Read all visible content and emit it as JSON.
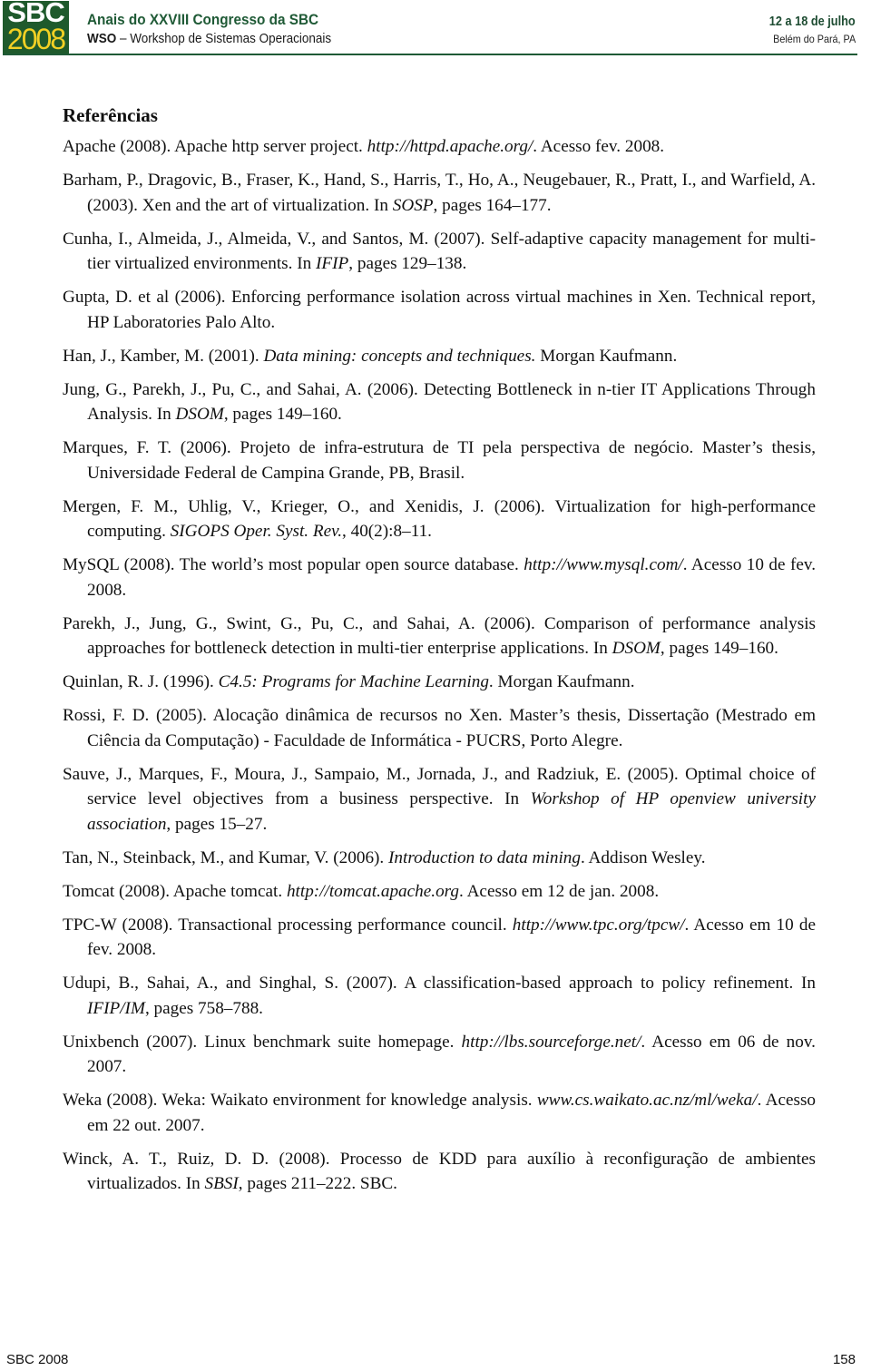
{
  "header": {
    "logo_line1": "SBC",
    "logo_line2": "2008",
    "title": "Anais do XXVIII Congresso da SBC",
    "subtitle_bold": "WSO",
    "subtitle_rest": " – Workshop de Sistemas Operacionais",
    "date": "12 a 18 de julho",
    "place": "Belém do Pará, PA",
    "colors": {
      "brand_green": "#1f5a2c",
      "logo_yellow": "#f2d024"
    }
  },
  "section_title": "Referências",
  "references": [
    [
      {
        "t": "Apache (2008). Apache http server project. "
      },
      {
        "t": "http://httpd.apache.org/",
        "i": true
      },
      {
        "t": ". Acesso fev. 2008."
      }
    ],
    [
      {
        "t": "Barham, P., Dragovic, B., Fraser, K., Hand, S., Harris, T., Ho, A., Neugebauer, R., Pratt, I., and Warfield, A. (2003). Xen and the art of virtualization. In "
      },
      {
        "t": "SOSP",
        "i": true
      },
      {
        "t": ", pages 164–177."
      }
    ],
    [
      {
        "t": "Cunha, I., Almeida, J., Almeida, V., and Santos, M. (2007). Self-adaptive capacity management for multi-tier virtualized environments. In "
      },
      {
        "t": "IFIP",
        "i": true
      },
      {
        "t": ", pages 129–138."
      }
    ],
    [
      {
        "t": "Gupta, D. et al (2006). Enforcing performance isolation across virtual machines in Xen. Technical report, HP Laboratories Palo Alto."
      }
    ],
    [
      {
        "t": "Han, J., Kamber, M. (2001). "
      },
      {
        "t": "Data mining: concepts and techniques.",
        "i": true
      },
      {
        "t": " Morgan Kaufmann."
      }
    ],
    [
      {
        "t": "Jung, G., Parekh, J., Pu, C., and Sahai, A. (2006). Detecting Bottleneck in n-tier IT Applications Through Analysis. In "
      },
      {
        "t": "DSOM",
        "i": true
      },
      {
        "t": ", pages 149–160."
      }
    ],
    [
      {
        "t": "Marques, F. T. (2006). Projeto de infra-estrutura de TI pela perspectiva de negócio. Master’s thesis, Universidade Federal de Campina Grande, PB, Brasil."
      }
    ],
    [
      {
        "t": "Mergen, F. M., Uhlig, V., Krieger, O., and Xenidis, J. (2006). Virtualization for high-performance computing. "
      },
      {
        "t": "SIGOPS Oper. Syst. Rev.",
        "i": true
      },
      {
        "t": ", 40(2):8–11."
      }
    ],
    [
      {
        "t": "MySQL (2008). The world’s most popular open source database. "
      },
      {
        "t": "http://www.mysql.com/",
        "i": true
      },
      {
        "t": ". Acesso 10 de fev. 2008."
      }
    ],
    [
      {
        "t": "Parekh, J., Jung, G., Swint, G., Pu, C., and Sahai, A. (2006). Comparison of performance analysis approaches for bottleneck detection in multi-tier enterprise applications. In "
      },
      {
        "t": "DSOM",
        "i": true
      },
      {
        "t": ", pages 149–160."
      }
    ],
    [
      {
        "t": "Quinlan, R. J. (1996). "
      },
      {
        "t": "C4.5: Programs for Machine Learning",
        "i": true
      },
      {
        "t": ". Morgan Kaufmann."
      }
    ],
    [
      {
        "t": "Rossi, F. D. (2005). Alocação dinâmica de recursos no Xen. Master’s thesis, Dissertação (Mestrado em Ciência da Computação) - Faculdade de Informática - PUCRS, Porto Alegre."
      }
    ],
    [
      {
        "t": "Sauve, J., Marques, F., Moura, J., Sampaio, M., Jornada, J., and Radziuk, E. (2005). Optimal choice of service level objectives from a business perspective. In "
      },
      {
        "t": "Workshop of HP openview university association",
        "i": true
      },
      {
        "t": ", pages 15–27."
      }
    ],
    [
      {
        "t": "Tan, N., Steinback, M., and Kumar, V. (2006). "
      },
      {
        "t": "Introduction to data mining",
        "i": true
      },
      {
        "t": ". Addison Wesley."
      }
    ],
    [
      {
        "t": "Tomcat (2008). Apache tomcat. "
      },
      {
        "t": "http://tomcat.apache.org",
        "i": true
      },
      {
        "t": ". Acesso em 12 de jan. 2008."
      }
    ],
    [
      {
        "t": "TPC-W (2008). Transactional processing performance council. "
      },
      {
        "t": "http://www.tpc.org/tpcw/",
        "i": true
      },
      {
        "t": ". Acesso em 10 de fev. 2008."
      }
    ],
    [
      {
        "t": "Udupi, B., Sahai, A., and Singhal, S. (2007). A classification-based approach to policy refinement. In "
      },
      {
        "t": "IFIP/IM",
        "i": true
      },
      {
        "t": ", pages 758–788."
      }
    ],
    [
      {
        "t": "Unixbench (2007). Linux benchmark suite homepage. "
      },
      {
        "t": "http://lbs.sourceforge.net/",
        "i": true
      },
      {
        "t": ". Acesso em 06 de nov. 2007."
      }
    ],
    [
      {
        "t": "Weka (2008). Weka: Waikato environment for knowledge analysis. "
      },
      {
        "t": "www.cs.waikato.ac.nz/ml/weka/",
        "i": true
      },
      {
        "t": ". Acesso em 22 out. 2007."
      }
    ],
    [
      {
        "t": "Winck, A. T., Ruiz, D. D. (2008). Processo de KDD para auxílio à reconfiguração de ambientes virtualizados. In "
      },
      {
        "t": "SBSI",
        "i": true
      },
      {
        "t": ", pages 211–222. SBC."
      }
    ]
  ],
  "footer": {
    "left": "SBC 2008",
    "page_number": "158"
  }
}
